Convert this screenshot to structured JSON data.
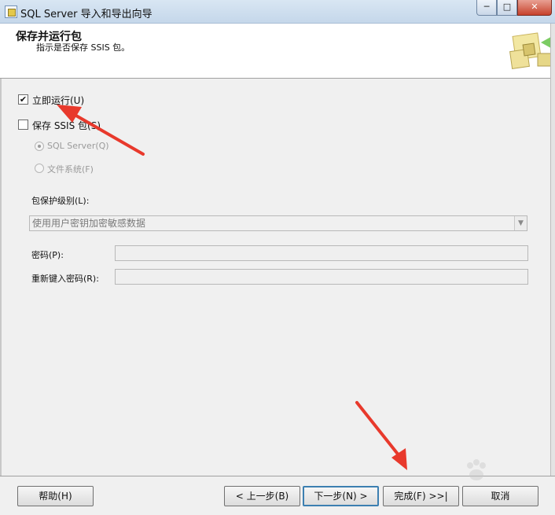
{
  "window": {
    "title": "SQL Server 导入和导出向导",
    "minimize_label": "─",
    "maximize_label": "□",
    "close_label": "✕"
  },
  "header": {
    "title": "保存并运行包",
    "subtitle": "指示是否保存 SSIS 包。"
  },
  "options": {
    "run_immediately": {
      "label": "立即运行(U)",
      "checked": true,
      "mark": "✔"
    },
    "save_ssis": {
      "label": "保存 SSIS 包(S)",
      "checked": false,
      "mark": ""
    },
    "sql_server": {
      "label": "SQL Server(Q)",
      "selected": true
    },
    "file_system": {
      "label": "文件系统(F)",
      "selected": false
    }
  },
  "protection": {
    "label": "包保护级别(L):",
    "value": "使用用户密钥加密敏感数据",
    "arrow": "▼"
  },
  "password": {
    "label": "密码(P):",
    "value": ""
  },
  "retype_password": {
    "label": "重新键入密码(R):",
    "value": ""
  },
  "buttons": {
    "help": "帮助(H)",
    "back": "< 上一步(B)",
    "next": "下一步(N) >",
    "finish": "完成(F) >>|",
    "cancel": "取消"
  },
  "colors": {
    "annotation": "#e8392c",
    "accent": "#3c7fb1"
  },
  "icons": {
    "app": "sql-wizard-app-icon",
    "wizard_graphic": "package-wizard-icon"
  }
}
